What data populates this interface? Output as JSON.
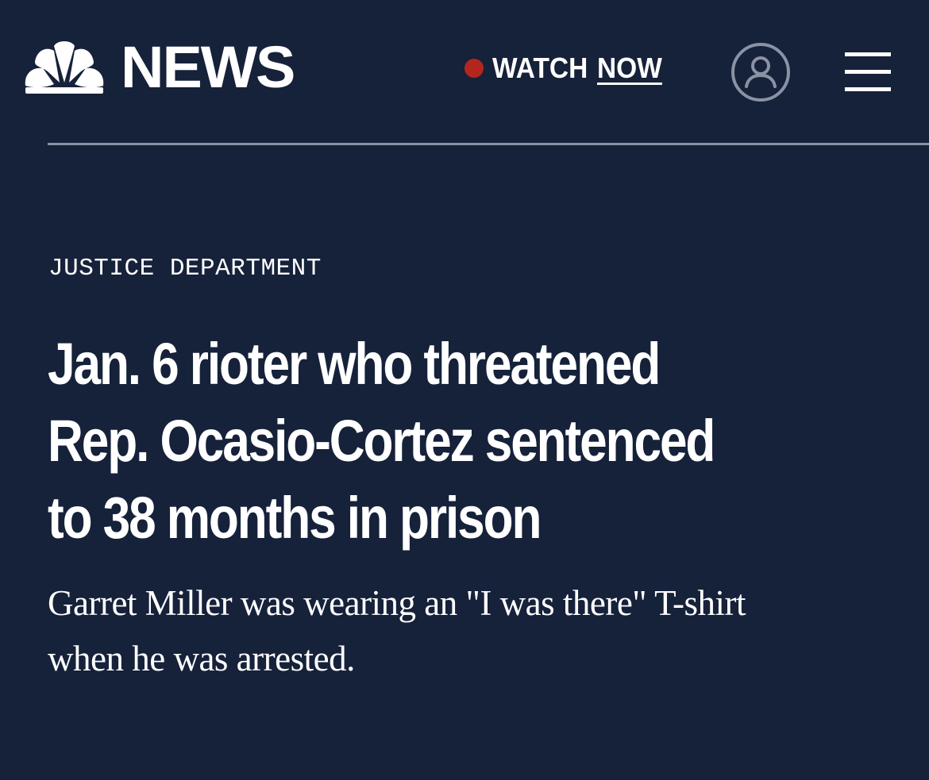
{
  "header": {
    "logo_text": "NEWS",
    "logo_icon": "nbc-peacock-icon",
    "watch_label": "WATCH",
    "watch_link": "NOW",
    "live_color": "#b3261e",
    "account_icon": "account-icon",
    "menu_icon": "hamburger-menu-icon"
  },
  "article": {
    "section": "JUSTICE DEPARTMENT",
    "headline_lines": [
      "Jan. 6 rioter who threatened",
      "Rep. Ocasio-Cortez sentenced",
      "to 38 months in prison"
    ],
    "dek_lines": [
      "Garret Miller was wearing an \"I was there\" T-shirt",
      "when he was arrested."
    ]
  },
  "colors": {
    "background": "#16213a",
    "text": "#ffffff",
    "divider": "#8a92a3"
  }
}
